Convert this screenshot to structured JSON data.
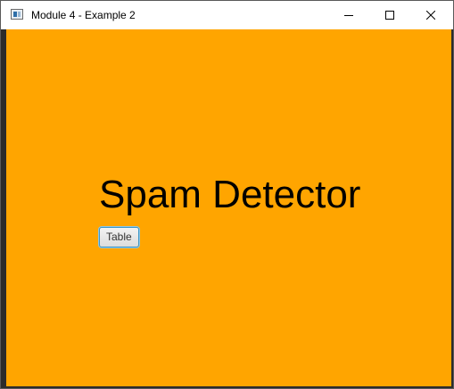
{
  "window": {
    "title": "Module 4 - Example 2"
  },
  "titlebar": {
    "icons": {
      "app": "app-window-icon",
      "minimize": "minimize-icon",
      "maximize": "maximize-icon",
      "close": "close-icon"
    }
  },
  "main": {
    "heading": "Spam Detector",
    "table_button_label": "Table",
    "background_color": "#ffa500"
  }
}
